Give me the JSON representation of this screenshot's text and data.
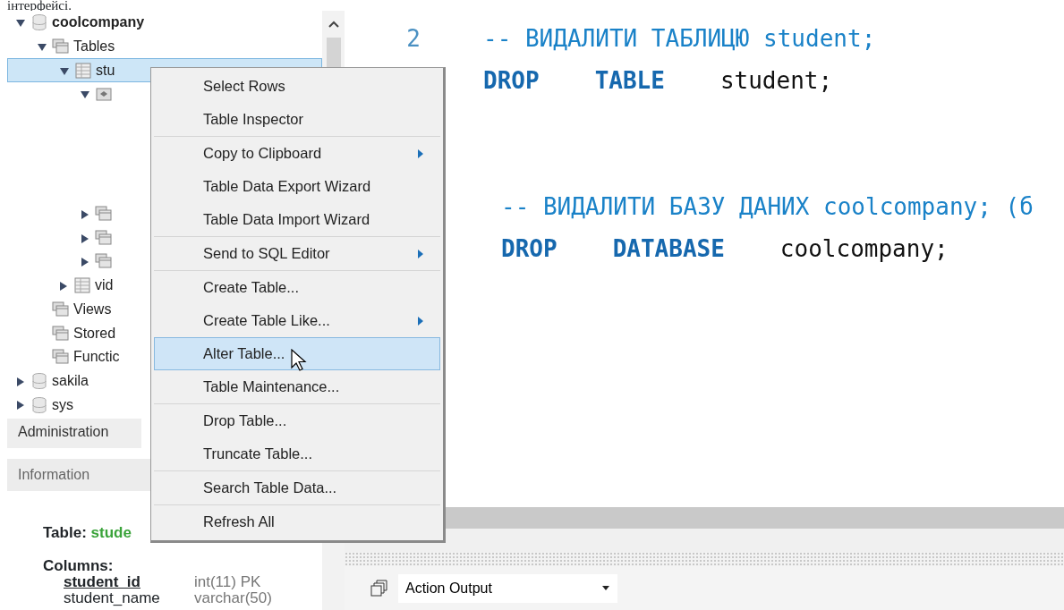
{
  "caption": "інтерфейсі.",
  "navigator": {
    "tree": [
      {
        "label": "coolcompany",
        "kind": "database",
        "expanded": true,
        "default": true,
        "children": [
          {
            "label": "Tables",
            "kind": "folder",
            "expanded": true,
            "children": [
              {
                "label": "stu",
                "kind": "table",
                "expanded": true,
                "selected": true,
                "children": [
                  {
                    "kind": "columns-folder",
                    "expanded": true
                  },
                  {
                    "kind": "index-folder",
                    "expanded": false
                  },
                  {
                    "kind": "key-folder",
                    "expanded": false
                  },
                  {
                    "kind": "trigger-folder",
                    "expanded": false
                  }
                ]
              },
              {
                "label": "vid",
                "kind": "table",
                "expanded": false,
                "selected": false
              }
            ]
          },
          {
            "label": "Views",
            "kind": "folder"
          },
          {
            "label": "Stored",
            "kind": "folder"
          },
          {
            "label": "Functic",
            "kind": "folder"
          }
        ]
      },
      {
        "label": "sakila",
        "kind": "database",
        "expanded": false,
        "default": false
      },
      {
        "label": "sys",
        "kind": "database",
        "expanded": false,
        "default": false
      }
    ]
  },
  "admin_tab": {
    "label": "Administration"
  },
  "info": {
    "header": "Information",
    "title_label": "Table:",
    "title_value": "stude",
    "columns_label": "Columns:",
    "columns": [
      {
        "name": "student_id",
        "type": "int(11) PK",
        "primary": true
      },
      {
        "name": "student_name",
        "type": "varchar(50)",
        "primary": false
      }
    ]
  },
  "context_menu": {
    "groups": [
      [
        {
          "label": "Select Rows",
          "submenu": false,
          "selected": false
        },
        {
          "label": "Table Inspector",
          "submenu": false,
          "selected": false
        }
      ],
      [
        {
          "label": "Copy to Clipboard",
          "submenu": true,
          "selected": false
        },
        {
          "label": "Table Data Export Wizard",
          "submenu": false,
          "selected": false
        },
        {
          "label": "Table Data Import Wizard",
          "submenu": false,
          "selected": false
        }
      ],
      [
        {
          "label": "Send to SQL Editor",
          "submenu": true,
          "selected": false
        }
      ],
      [
        {
          "label": "Create Table...",
          "submenu": false,
          "selected": false
        },
        {
          "label": "Create Table Like...",
          "submenu": true,
          "selected": false
        },
        {
          "label": "Alter Table...",
          "submenu": false,
          "selected": true
        },
        {
          "label": "Table Maintenance...",
          "submenu": false,
          "selected": false
        }
      ],
      [
        {
          "label": "Drop Table...",
          "submenu": false,
          "selected": false
        },
        {
          "label": "Truncate Table...",
          "submenu": false,
          "selected": false
        }
      ],
      [
        {
          "label": "Search Table Data...",
          "submenu": false,
          "selected": false
        }
      ],
      [
        {
          "label": "Refresh All",
          "submenu": false,
          "selected": false
        }
      ]
    ]
  },
  "editor": {
    "blocks": [
      {
        "lines": [
          {
            "number": "2",
            "tokens": [
              {
                "text": "-- ВИДАЛИТИ ТАБЛИЦЮ student;",
                "kind": "comment"
              }
            ]
          },
          {
            "tokens": [
              {
                "text": "DROP",
                "kind": "keyword"
              },
              {
                "text": "TABLE",
                "kind": "keyword"
              },
              {
                "text": "student;",
                "kind": "plain"
              }
            ]
          }
        ]
      },
      {
        "lines": [
          {
            "tokens": [
              {
                "text": "-- ВИДАЛИТИ БАЗУ ДАНИХ coolcompany; (б",
                "kind": "comment"
              }
            ]
          },
          {
            "tokens": [
              {
                "text": "DROP",
                "kind": "keyword"
              },
              {
                "text": "DATABASE",
                "kind": "keyword"
              },
              {
                "text": "coolcompany;",
                "kind": "plain"
              }
            ]
          }
        ]
      }
    ]
  },
  "output": {
    "label": "Action Output"
  }
}
